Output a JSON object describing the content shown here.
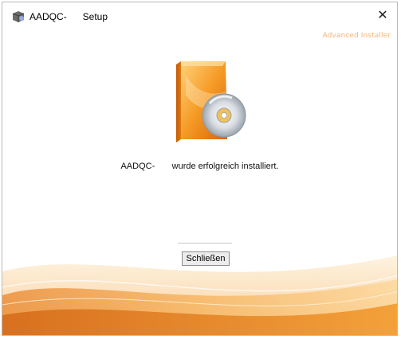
{
  "window": {
    "title": "AADQC-      Setup",
    "close_glyph": "✕",
    "app_icon": "installer-box-icon"
  },
  "branding": {
    "text": "Advanced Installer"
  },
  "content": {
    "product_icon": "software-box-cd-icon",
    "message": "AADQC-       wurde erfolgreich installiert."
  },
  "buttons": {
    "close_label": "Schließen"
  },
  "colors": {
    "accent_orange": "#f39a2e",
    "brand_text": "#f6b37a"
  }
}
